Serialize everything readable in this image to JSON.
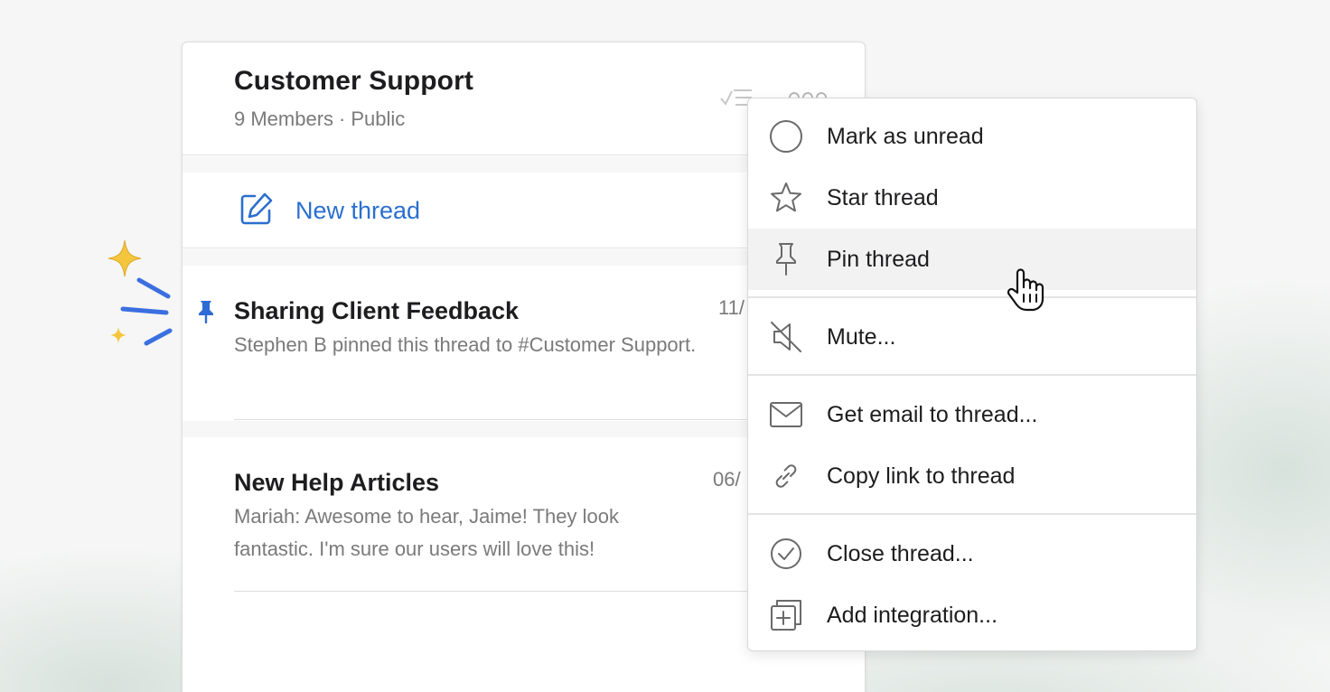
{
  "channel": {
    "title": "Customer Support",
    "members": "9 Members",
    "separator": "·",
    "visibility": "Public"
  },
  "new_thread": {
    "label": "New thread"
  },
  "threads": [
    {
      "title": "Sharing Client Feedback",
      "date": "11/",
      "preview": "Stephen B pinned this thread to #Customer Support.",
      "pinned": true
    },
    {
      "title": "New Help Articles",
      "date": "06/",
      "preview": "Mariah: Awesome to hear, Jaime! They look fantastic. I'm sure our users will love this!",
      "pinned": false
    }
  ],
  "context_menu": {
    "groups": [
      [
        {
          "label": "Mark as unread",
          "icon": "circle-icon"
        },
        {
          "label": "Star thread",
          "icon": "star-icon"
        },
        {
          "label": "Pin thread",
          "icon": "pin-icon",
          "hovered": true
        }
      ],
      [
        {
          "label": "Mute...",
          "icon": "mute-icon"
        }
      ],
      [
        {
          "label": "Get email to thread...",
          "icon": "envelope-icon"
        },
        {
          "label": "Copy link to thread",
          "icon": "link-icon"
        }
      ],
      [
        {
          "label": "Close thread...",
          "icon": "check-circle-icon"
        },
        {
          "label": "Add integration...",
          "icon": "add-integration-icon"
        }
      ]
    ]
  },
  "colors": {
    "accent": "#2b6fcf",
    "pin": "#2d6bd6",
    "hover": "#f2f2f2",
    "sparkle_yellow": "#f4c63d",
    "sparkle_blue": "#3b6fe0"
  }
}
